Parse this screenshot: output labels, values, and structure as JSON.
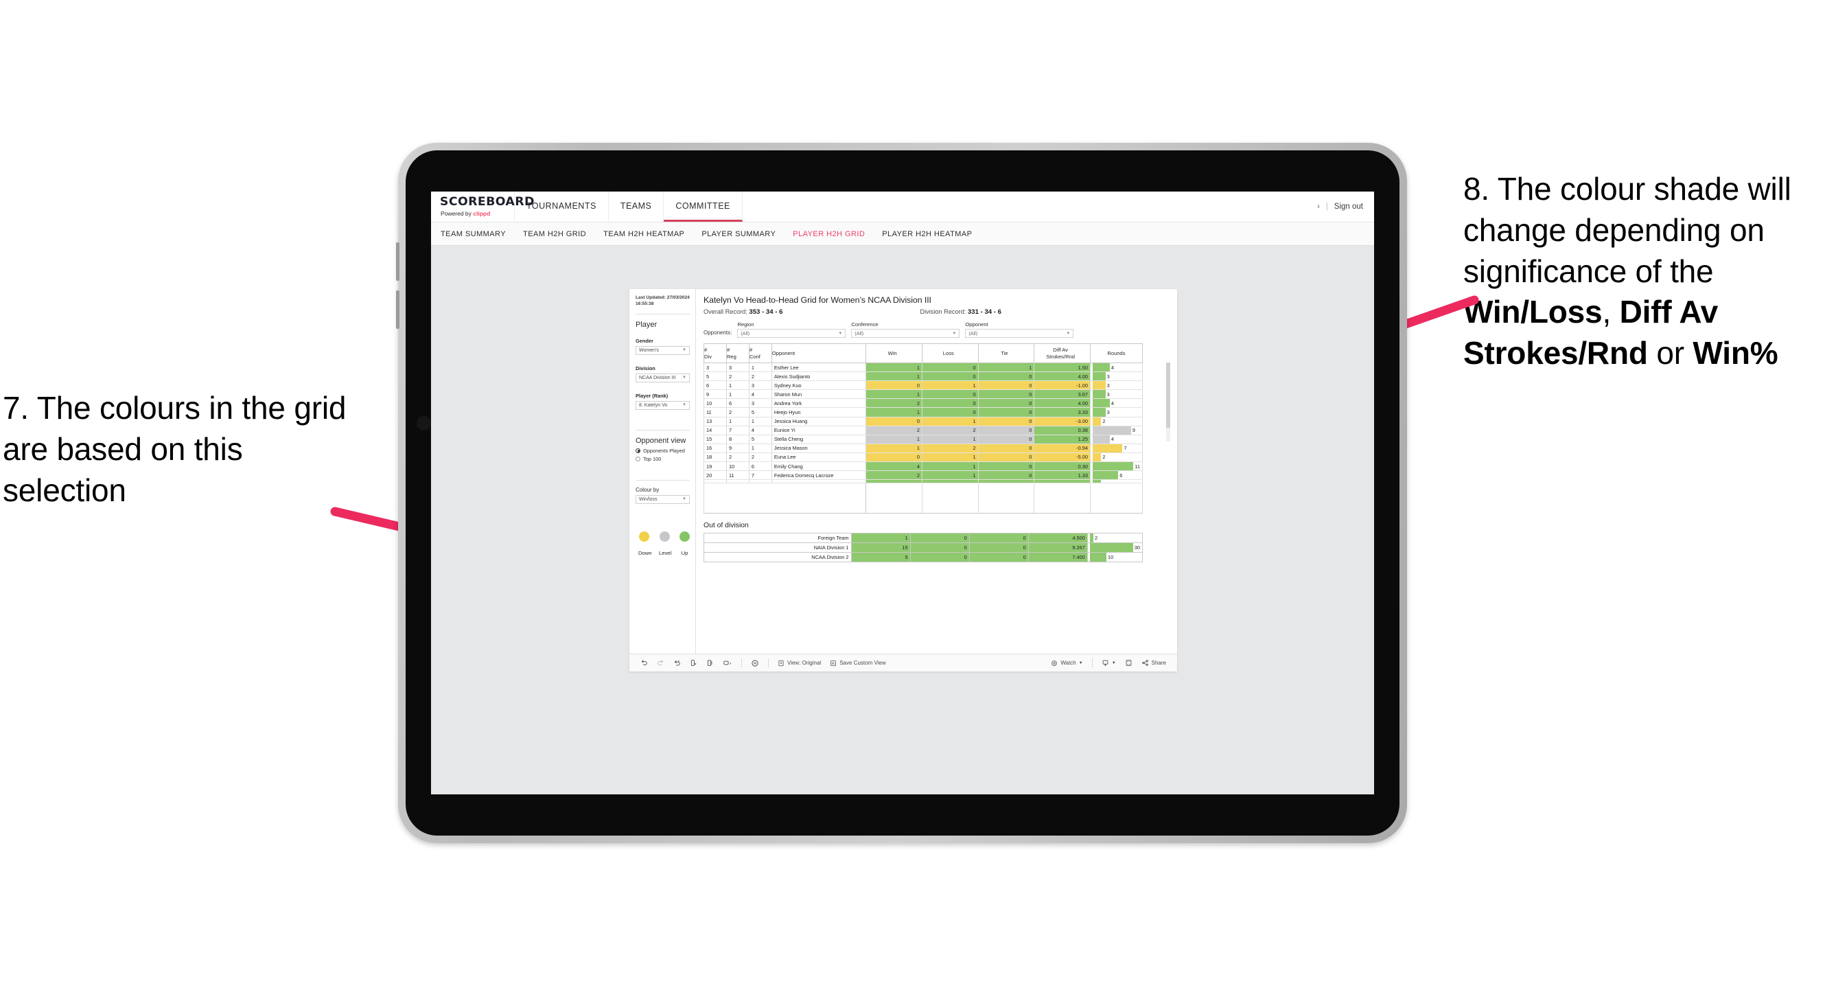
{
  "annotations": {
    "left": {
      "text": "7. The colours in the grid are based on this selection",
      "arrow_color": "#ec2a5e"
    },
    "right": {
      "prefix": "8. The colour shade will change depending on significance of the ",
      "bold1": "Win/Loss",
      "mid1": ", ",
      "bold2": "Diff Av Strokes/Rnd",
      "mid2": " or ",
      "bold3": "Win%",
      "arrow_color": "#ec2a5e"
    }
  },
  "app": {
    "brand": {
      "name": "SCOREBOARD",
      "powered_prefix": "Powered by ",
      "powered_by": "clippd"
    },
    "nav": [
      {
        "label": "TOURNAMENTS",
        "active": false
      },
      {
        "label": "TEAMS",
        "active": false
      },
      {
        "label": "COMMITTEE",
        "active": true
      }
    ],
    "right": {
      "chevron": "›",
      "separator": "|",
      "signout": "Sign out"
    },
    "subnav": [
      {
        "label": "TEAM SUMMARY",
        "active": false
      },
      {
        "label": "TEAM H2H GRID",
        "active": false
      },
      {
        "label": "TEAM H2H HEATMAP",
        "active": false
      },
      {
        "label": "PLAYER SUMMARY",
        "active": false
      },
      {
        "label": "PLAYER H2H GRID",
        "active": true
      },
      {
        "label": "PLAYER H2H HEATMAP",
        "active": false
      }
    ]
  },
  "sidebar": {
    "last_updated": "Last Updated: 27/03/2024 16:55:38",
    "player_heading": "Player",
    "fields": [
      {
        "label": "Gender",
        "value": "Women’s"
      },
      {
        "label": "Division",
        "value": "NCAA Division III"
      },
      {
        "label": "Player (Rank)",
        "value": "8. Katelyn Vo"
      }
    ],
    "opponent_view": {
      "heading": "Opponent view",
      "options": [
        {
          "label": "Opponents Played",
          "selected": true
        },
        {
          "label": "Top 100",
          "selected": false
        }
      ]
    },
    "colour_by": {
      "label": "Colour by",
      "value": "Win/loss"
    },
    "legend": [
      {
        "label": "Down",
        "color": "#f2d047"
      },
      {
        "label": "Level",
        "color": "#c6c7ca"
      },
      {
        "label": "Up",
        "color": "#84c565"
      }
    ]
  },
  "viz": {
    "title": "Katelyn Vo Head-to-Head Grid for Women’s NCAA Division III",
    "overall_record_label": "Overall Record: ",
    "overall_record": "353 -  34 - 6",
    "division_record_label": "Division Record: ",
    "division_record": "331 -  34 - 6",
    "opponents_label": "Opponents:",
    "filters": [
      {
        "label": "Region",
        "value": "(All)"
      },
      {
        "label": "Conference",
        "value": "(All)"
      },
      {
        "label": "Opponent",
        "value": "(All)"
      }
    ],
    "columns": [
      "# Div",
      "# Reg",
      "# Conf",
      "Opponent",
      "Win",
      "Loss",
      "Tie",
      "Diff Av Strokes/Rnd",
      "Rounds"
    ],
    "rows": [
      {
        "div": "3",
        "reg": "3",
        "conf": "1",
        "opponent": "Esther Lee",
        "win": "1",
        "loss": "0",
        "tie": "1",
        "diff": "1.50",
        "rounds": "4",
        "color": "#8fc96e",
        "bar_pct": 36
      },
      {
        "div": "5",
        "reg": "2",
        "conf": "2",
        "opponent": "Alexis Sudjianto",
        "win": "1",
        "loss": "0",
        "tie": "0",
        "diff": "4.00",
        "rounds": "3",
        "color": "#8fc96e",
        "bar_pct": 27
      },
      {
        "div": "6",
        "reg": "1",
        "conf": "3",
        "opponent": "Sydney Kuo",
        "win": "0",
        "loss": "1",
        "tie": "0",
        "diff": "-1.00",
        "rounds": "3",
        "color": "#f5d45c",
        "bar_pct": 27
      },
      {
        "div": "9",
        "reg": "1",
        "conf": "4",
        "opponent": "Sharon Mun",
        "win": "1",
        "loss": "0",
        "tie": "0",
        "diff": "3.67",
        "rounds": "3",
        "color": "#8fc96e",
        "bar_pct": 27
      },
      {
        "div": "10",
        "reg": "6",
        "conf": "3",
        "opponent": "Andrea York",
        "win": "2",
        "loss": "0",
        "tie": "0",
        "diff": "4.00",
        "rounds": "4",
        "color": "#8fc96e",
        "bar_pct": 36
      },
      {
        "div": "11",
        "reg": "2",
        "conf": "5",
        "opponent": "Heejo Hyun",
        "win": "1",
        "loss": "0",
        "tie": "0",
        "diff": "3.33",
        "rounds": "3",
        "color": "#8fc96e",
        "bar_pct": 27
      },
      {
        "div": "13",
        "reg": "1",
        "conf": "1",
        "opponent": "Jessica Huang",
        "win": "0",
        "loss": "1",
        "tie": "0",
        "diff": "-3.00",
        "rounds": "2",
        "color": "#f5d45c",
        "bar_pct": 18
      },
      {
        "div": "14",
        "reg": "7",
        "conf": "4",
        "opponent": "Eunice Yi",
        "win": "2",
        "loss": "2",
        "tie": "0",
        "diff": "0.38",
        "rounds": "9",
        "color": "#cdcdcd",
        "diff_color": "#8fc96e",
        "bar_pct": 81
      },
      {
        "div": "15",
        "reg": "8",
        "conf": "5",
        "opponent": "Stella Cheng",
        "win": "1",
        "loss": "1",
        "tie": "0",
        "diff": "1.25",
        "rounds": "4",
        "color": "#cdcdcd",
        "diff_color": "#8fc96e",
        "bar_pct": 36
      },
      {
        "div": "16",
        "reg": "9",
        "conf": "1",
        "opponent": "Jessica Mason",
        "win": "1",
        "loss": "2",
        "tie": "0",
        "diff": "-0.94",
        "rounds": "7",
        "color": "#f5d45c",
        "bar_pct": 63
      },
      {
        "div": "18",
        "reg": "2",
        "conf": "2",
        "opponent": "Euna Lee",
        "win": "0",
        "loss": "1",
        "tie": "0",
        "diff": "-5.00",
        "rounds": "2",
        "color": "#f5d45c",
        "bar_pct": 18
      },
      {
        "div": "19",
        "reg": "10",
        "conf": "6",
        "opponent": "Emily Chang",
        "win": "4",
        "loss": "1",
        "tie": "0",
        "diff": "0.30",
        "rounds": "11",
        "color": "#8fc96e",
        "bar_pct": 100
      },
      {
        "div": "20",
        "reg": "11",
        "conf": "7",
        "opponent": "Federica Domecq Lacroze",
        "win": "2",
        "loss": "1",
        "tie": "0",
        "diff": "1.33",
        "rounds": "6",
        "color": "#8fc96e",
        "bar_pct": 54
      }
    ],
    "out_of_division": {
      "heading": "Out of division",
      "rows": [
        {
          "name": "Foreign Team",
          "win": "1",
          "loss": "0",
          "tie": "0",
          "diff": "4.500",
          "rounds": "2",
          "color": "#8fc96e",
          "bar_pct": 7
        },
        {
          "name": "NAIA Division 1",
          "win": "15",
          "loss": "0",
          "tie": "0",
          "diff": "9.267",
          "rounds": "30",
          "color": "#8fc96e",
          "bar_pct": 100
        },
        {
          "name": "NCAA Division 2",
          "win": "5",
          "loss": "0",
          "tie": "0",
          "diff": "7.400",
          "rounds": "10",
          "color": "#8fc96e",
          "bar_pct": 33
        }
      ]
    },
    "toolbar": {
      "undo": "undo-icon",
      "redo": "redo-icon",
      "revert": "revert-icon",
      "refresh": "refresh-data-icon",
      "pause": "pause-updates-icon",
      "view_original": "View: Original",
      "save_custom_view": "Save Custom View",
      "watch": "Watch",
      "share": "Share"
    }
  }
}
